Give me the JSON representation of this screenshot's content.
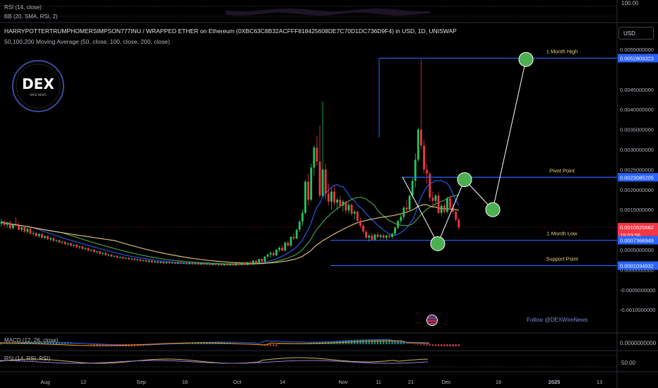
{
  "header": {
    "title": "HARRYPOTTERTRUMPHOMERSIMPSON777INU / WRAPPED ETHER on Ethereum (0XBC63C8B32ACFFF818425608DE7C70D1DC736D9F4) in USD, 1D, UNISWAP",
    "indicator": "50,100,200 Moving Average (50, close, 100, close, 200, close)",
    "currency_button": "USD"
  },
  "top_panes": {
    "rsi_label": "RSI (14, close)",
    "bb_label": "BB (20, SMA, RSI, 2)",
    "axis_label": "100.00"
  },
  "bottom_panes": {
    "macd_label": "MACD (12, 26, close)",
    "macd_axis": "0.0000000000",
    "rsi_label": "RSI (14, RSI, RSI)",
    "rsi_axis": "50.00"
  },
  "logo": {
    "text": "DEX",
    "subtext": "WIRE NEWS"
  },
  "footer_note": "Follow @DEXWireNews",
  "chart_data": {
    "type": "candlestick",
    "y_axis": {
      "min": -0.0012,
      "max": 0.0058,
      "ticks": [
        0.0055,
        0.0045,
        0.004,
        0.0035,
        0.003,
        0.0025,
        0.002,
        0.0015,
        0.0005,
        0.0,
        -0.0005,
        -0.001
      ],
      "tick_labels": [
        "0.0055000000",
        "0.0045000000",
        "0.0040000000",
        "0.0035000000",
        "0.0030000000",
        "0.0025000000",
        "0.0020000000",
        "0.0015000000",
        "0.0005000000",
        "0.0000000000",
        "-0.0005000000",
        "-0.0010000000"
      ]
    },
    "x_axis": {
      "tick_labels": [
        "Aug",
        "12",
        "Sep",
        "16",
        "Oct",
        "14",
        "Nov",
        "11",
        "21",
        "Dec",
        "16",
        "2025",
        "13"
      ],
      "tick_days": [
        -2,
        10,
        29,
        59,
        96,
        162,
        151,
        150,
        190,
        212,
        248,
        266,
        273
      ]
    },
    "candles": [
      [
        0.00115,
        0.00128,
        0.00108,
        0.0012
      ],
      [
        0.0012,
        0.00125,
        0.0011,
        0.00112
      ],
      [
        0.00112,
        0.0012,
        0.00105,
        0.00118
      ],
      [
        0.00118,
        0.00122,
        0.001,
        0.00104
      ],
      [
        0.00104,
        0.00115,
        0.001,
        0.00112
      ],
      [
        0.00112,
        0.0013,
        0.00108,
        0.0011
      ],
      [
        0.0011,
        0.00118,
        0.00098,
        0.001
      ],
      [
        0.001,
        0.00108,
        0.00095,
        0.00106
      ],
      [
        0.00106,
        0.0011,
        0.00092,
        0.00095
      ],
      [
        0.00095,
        0.00105,
        0.0009,
        0.00102
      ],
      [
        0.00102,
        0.00106,
        0.00088,
        0.0009
      ],
      [
        0.0009,
        0.00098,
        0.00085,
        0.00092
      ],
      [
        0.00092,
        0.00095,
        0.00082,
        0.00084
      ],
      [
        0.00084,
        0.00092,
        0.0008,
        0.00089
      ],
      [
        0.00089,
        0.00092,
        0.00078,
        0.0008
      ],
      [
        0.0008,
        0.00086,
        0.00076,
        0.00084
      ],
      [
        0.00084,
        0.00086,
        0.00074,
        0.00076
      ],
      [
        0.00076,
        0.00082,
        0.00072,
        0.00079
      ],
      [
        0.00079,
        0.00082,
        0.0007,
        0.00072
      ],
      [
        0.00072,
        0.00076,
        0.00068,
        0.00074
      ],
      [
        0.00074,
        0.00076,
        0.00066,
        0.00068
      ],
      [
        0.00068,
        0.00072,
        0.00064,
        0.0007
      ],
      [
        0.0007,
        0.00072,
        0.00062,
        0.00064
      ],
      [
        0.00064,
        0.00068,
        0.0006,
        0.00066
      ],
      [
        0.00066,
        0.00068,
        0.00058,
        0.0006
      ],
      [
        0.0006,
        0.00064,
        0.00056,
        0.00062
      ],
      [
        0.00062,
        0.00064,
        0.00054,
        0.00056
      ],
      [
        0.00056,
        0.0006,
        0.00052,
        0.00058
      ],
      [
        0.00058,
        0.0006,
        0.0005,
        0.00052
      ],
      [
        0.00052,
        0.00056,
        0.00048,
        0.00054
      ],
      [
        0.00054,
        0.00056,
        0.00046,
        0.00048
      ],
      [
        0.00048,
        0.00052,
        0.00044,
        0.0005
      ],
      [
        0.0005,
        0.00052,
        0.00042,
        0.00044
      ],
      [
        0.00044,
        0.00048,
        0.0004,
        0.00046
      ],
      [
        0.00046,
        0.00048,
        0.00038,
        0.0004
      ],
      [
        0.0004,
        0.00044,
        0.00036,
        0.00042
      ],
      [
        0.00042,
        0.00044,
        0.00035,
        0.00036
      ],
      [
        0.00036,
        0.0004,
        0.00033,
        0.00038
      ],
      [
        0.00038,
        0.0004,
        0.00032,
        0.00033
      ],
      [
        0.00033,
        0.00036,
        0.0003,
        0.00035
      ],
      [
        0.00035,
        0.00036,
        0.00029,
        0.0003
      ],
      [
        0.0003,
        0.00033,
        0.00028,
        0.00032
      ],
      [
        0.00032,
        0.00033,
        0.00027,
        0.00028
      ],
      [
        0.00028,
        0.00031,
        0.00026,
        0.0003
      ],
      [
        0.0003,
        0.00031,
        0.00025,
        0.00026
      ],
      [
        0.00026,
        0.00029,
        0.00024,
        0.00028
      ],
      [
        0.00028,
        0.00029,
        0.00023,
        0.00024
      ],
      [
        0.00024,
        0.00027,
        0.00022,
        0.00026
      ],
      [
        0.00026,
        0.00027,
        0.00021,
        0.00022
      ],
      [
        0.00022,
        0.00025,
        0.0002,
        0.00024
      ],
      [
        0.00024,
        0.00025,
        0.00019,
        0.0002
      ],
      [
        0.0002,
        0.00024,
        0.00018,
        0.00023
      ],
      [
        0.00023,
        0.00024,
        0.00017,
        0.00018
      ],
      [
        0.00018,
        0.00022,
        0.00017,
        0.00021
      ],
      [
        0.00021,
        0.00022,
        0.00016,
        0.00017
      ],
      [
        0.00017,
        0.00021,
        0.00016,
        0.0002
      ],
      [
        0.0002,
        0.00021,
        0.00015,
        0.00016
      ],
      [
        0.00016,
        0.0002,
        0.00015,
        0.00019
      ],
      [
        0.00019,
        0.0002,
        0.00015,
        0.00016
      ],
      [
        0.00016,
        0.00019,
        0.00015,
        0.00018
      ],
      [
        0.00018,
        0.00019,
        0.00014,
        0.00015
      ],
      [
        0.00015,
        0.00019,
        0.00014,
        0.00018
      ],
      [
        0.00018,
        0.00019,
        0.00014,
        0.00015
      ],
      [
        0.00015,
        0.00018,
        0.00014,
        0.00017
      ],
      [
        0.00017,
        0.00018,
        0.00013,
        0.00014
      ],
      [
        0.00014,
        0.00018,
        0.00013,
        0.00017
      ],
      [
        0.00017,
        0.00018,
        0.00013,
        0.00014
      ],
      [
        0.00014,
        0.00017,
        0.00013,
        0.00016
      ],
      [
        0.00016,
        0.00017,
        0.00012,
        0.00013
      ],
      [
        0.00013,
        0.00017,
        0.00012,
        0.00016
      ],
      [
        0.00016,
        0.00017,
        0.00012,
        0.00013
      ],
      [
        0.00013,
        0.00016,
        0.00012,
        0.00015
      ],
      [
        0.00015,
        0.00016,
        0.00011,
        0.00012
      ],
      [
        0.00012,
        0.00016,
        0.00011,
        0.00015
      ],
      [
        0.00015,
        0.00016,
        0.00011,
        0.00012
      ],
      [
        0.00012,
        0.00015,
        0.0001,
        0.00014
      ],
      [
        0.00014,
        0.00015,
        0.0001,
        0.00011
      ],
      [
        0.00011,
        0.00015,
        0.0001,
        0.00014
      ],
      [
        0.00014,
        0.00015,
        0.0001,
        0.00011
      ],
      [
        0.00011,
        0.00016,
        0.0001,
        0.00015
      ],
      [
        0.00015,
        0.00016,
        0.0001,
        0.00011
      ],
      [
        0.00011,
        0.00017,
        0.0001,
        0.00016
      ],
      [
        0.00016,
        0.00017,
        0.0001,
        0.00012
      ],
      [
        0.00012,
        0.00018,
        0.00011,
        0.00017
      ],
      [
        0.00017,
        0.00019,
        0.00011,
        0.00012
      ],
      [
        0.00012,
        0.0002,
        0.00011,
        0.00019
      ],
      [
        0.00019,
        0.00021,
        0.00012,
        0.00013
      ],
      [
        0.00013,
        0.00024,
        0.00012,
        0.00023
      ],
      [
        0.00023,
        0.00025,
        0.00014,
        0.00016
      ],
      [
        0.00016,
        0.00028,
        0.00015,
        0.00027
      ],
      [
        0.00027,
        0.00029,
        0.00018,
        0.0002
      ],
      [
        0.0002,
        0.00034,
        0.00019,
        0.00033
      ],
      [
        0.00033,
        0.0004,
        0.00028,
        0.00038
      ],
      [
        0.00038,
        0.00046,
        0.0003,
        0.00042
      ],
      [
        0.00042,
        0.00046,
        0.00032,
        0.00036
      ],
      [
        0.00036,
        0.00052,
        0.00034,
        0.0005
      ],
      [
        0.0005,
        0.00058,
        0.00044,
        0.00055
      ],
      [
        0.00055,
        0.00062,
        0.00046,
        0.00048
      ],
      [
        0.00048,
        0.0007,
        0.00046,
        0.00068
      ],
      [
        0.00068,
        0.00072,
        0.00058,
        0.0006
      ],
      [
        0.0006,
        0.00084,
        0.00058,
        0.00082
      ],
      [
        0.00082,
        0.00092,
        0.00074,
        0.00078
      ],
      [
        0.00078,
        0.00102,
        0.00076,
        0.001
      ],
      [
        0.001,
        0.00124,
        0.00094,
        0.0012
      ],
      [
        0.0012,
        0.0015,
        0.0011,
        0.00142
      ],
      [
        0.00142,
        0.00225,
        0.00138,
        0.0022
      ],
      [
        0.0022,
        0.0024,
        0.0016,
        0.00175
      ],
      [
        0.00175,
        0.00265,
        0.0017,
        0.00255
      ],
      [
        0.00255,
        0.0031,
        0.00235,
        0.00305
      ],
      [
        0.00305,
        0.00335,
        0.0026,
        0.0027
      ],
      [
        0.0027,
        0.0036,
        0.0018,
        0.00185
      ],
      [
        0.00185,
        0.0042,
        0.0018,
        0.0025
      ],
      [
        0.0025,
        0.00265,
        0.00175,
        0.0019
      ],
      [
        0.0019,
        0.00215,
        0.0016,
        0.0017
      ],
      [
        0.0017,
        0.00205,
        0.0015,
        0.00195
      ],
      [
        0.00195,
        0.0021,
        0.0016,
        0.00168
      ],
      [
        0.00168,
        0.0018,
        0.0015,
        0.00175
      ],
      [
        0.00175,
        0.00185,
        0.00155,
        0.0016
      ],
      [
        0.0016,
        0.00175,
        0.00145,
        0.0017
      ],
      [
        0.0017,
        0.00172,
        0.0014,
        0.00148
      ],
      [
        0.00148,
        0.00168,
        0.0014,
        0.00162
      ],
      [
        0.00162,
        0.00166,
        0.00135,
        0.0014
      ],
      [
        0.0014,
        0.0015,
        0.00125,
        0.00145
      ],
      [
        0.00145,
        0.00148,
        0.00118,
        0.00122
      ],
      [
        0.00122,
        0.0013,
        0.00105,
        0.0011
      ],
      [
        0.0011,
        0.00115,
        0.0009,
        0.00095
      ],
      [
        0.00095,
        0.001,
        0.00078,
        0.0008
      ],
      [
        0.0008,
        0.0009,
        0.0007,
        0.00085
      ],
      [
        0.00085,
        0.00092,
        0.00072,
        0.00075
      ],
      [
        0.00075,
        0.0009,
        0.00072,
        0.00088
      ],
      [
        0.00088,
        0.00094,
        0.00078,
        0.00082
      ],
      [
        0.00082,
        0.0009,
        0.00076,
        0.00086
      ],
      [
        0.00086,
        0.0009,
        0.00076,
        0.0008
      ],
      [
        0.0008,
        0.00088,
        0.00075,
        0.00085
      ],
      [
        0.00085,
        0.0009,
        0.00078,
        0.00082
      ],
      [
        0.00082,
        0.00092,
        0.00078,
        0.0009
      ],
      [
        0.0009,
        0.00108,
        0.00085,
        0.00105
      ],
      [
        0.00105,
        0.00125,
        0.001,
        0.00122
      ],
      [
        0.00122,
        0.00138,
        0.00115,
        0.00132
      ],
      [
        0.00132,
        0.0016,
        0.00125,
        0.00155
      ],
      [
        0.00155,
        0.00175,
        0.0014,
        0.0015
      ],
      [
        0.0015,
        0.00188,
        0.00145,
        0.00185
      ],
      [
        0.00185,
        0.0023,
        0.0018,
        0.00222
      ],
      [
        0.00222,
        0.0029,
        0.00205,
        0.00275
      ],
      [
        0.00275,
        0.00355,
        0.0027,
        0.0035
      ],
      [
        0.0035,
        0.00525,
        0.003,
        0.0031
      ],
      [
        0.0031,
        0.00325,
        0.0024,
        0.0025
      ],
      [
        0.0025,
        0.00265,
        0.00215,
        0.0024
      ],
      [
        0.0024,
        0.00245,
        0.0017,
        0.0018
      ],
      [
        0.0018,
        0.00195,
        0.0016,
        0.00172
      ],
      [
        0.00172,
        0.0019,
        0.0016,
        0.00185
      ],
      [
        0.00185,
        0.00195,
        0.0014,
        0.00142
      ],
      [
        0.00142,
        0.00165,
        0.00135,
        0.0016
      ],
      [
        0.0016,
        0.00168,
        0.0014,
        0.00145
      ],
      [
        0.00145,
        0.00182,
        0.0014,
        0.00178
      ],
      [
        0.00178,
        0.00185,
        0.0015,
        0.00155
      ],
      [
        0.00155,
        0.00165,
        0.0014,
        0.00145
      ],
      [
        0.00145,
        0.0015,
        0.0012,
        0.00125
      ],
      [
        0.00125,
        0.0013,
        0.001,
        0.00106
      ]
    ],
    "moving_averages": [
      {
        "name": "MA 50",
        "color": "#2962ff"
      },
      {
        "name": "MA 100",
        "color": "#4caf50"
      },
      {
        "name": "MA 200",
        "color": "#f0d080"
      }
    ],
    "levels": [
      {
        "name": "1 Month High",
        "price": 0.0052809323,
        "price_label": "0.0052809323"
      },
      {
        "name": "Pivot Point",
        "price": 0.0023085205,
        "price_label": "0.0023085205"
      },
      {
        "name": "1 Month Low",
        "price": 0.0007366949,
        "price_label": "0.0007366949"
      },
      {
        "name": "Support Point",
        "price": 0.0001034932,
        "price_label": "0.0001034932"
      }
    ],
    "current_price": {
      "value": 0.0010625682,
      "label": "0.0010625682",
      "countdown": "15:03:56"
    },
    "projection": [
      0.00065,
      0.00225,
      0.0015,
      0.00525
    ],
    "colors": {
      "up": "#089981",
      "up_bright": "#22c55e",
      "down": "#f23645",
      "level": "#2962ff",
      "level_label": "#e8d27a",
      "projection": "#4caf50",
      "price_tag": "#f23645"
    }
  }
}
